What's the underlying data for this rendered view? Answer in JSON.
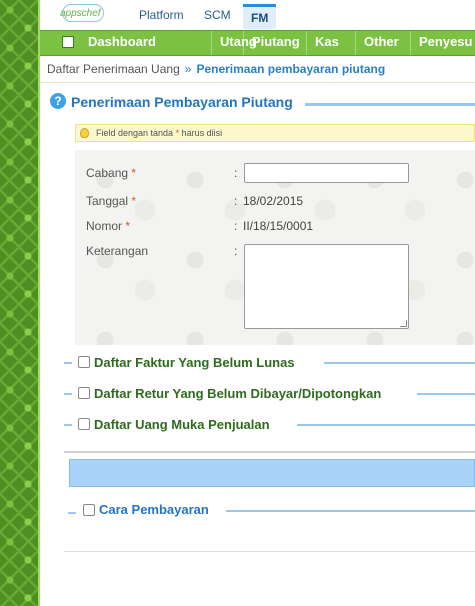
{
  "top_nav": {
    "logo": "appschef",
    "tabs": [
      "Platform",
      "SCM",
      "FM"
    ],
    "active_tab": "FM"
  },
  "menu": {
    "items": [
      "Dashboard",
      "Utang",
      "Piutang",
      "Kas",
      "Other",
      "Penyesu"
    ]
  },
  "breadcrumb": {
    "parent": "Daftar Penerimaan Uang",
    "separator": "»",
    "current": "Penerimaan pembayaran piutang"
  },
  "page": {
    "title": "Penerimaan Pembayaran Piutang"
  },
  "notice": {
    "prefix": "Field dengan tanda",
    "star": "*",
    "suffix": "harus diisi"
  },
  "form": {
    "cabang_label": "Cabang",
    "tanggal_label": "Tanggal",
    "tanggal_value": "18/02/2015",
    "nomor_label": "Nomor",
    "nomor_value": "II/18/15/0001",
    "keterangan_label": "Keterangan",
    "required_mark": "*",
    "colon": ":"
  },
  "sections": {
    "faktur": "Daftar Faktur Yang Belum Lunas",
    "retur": "Daftar Retur Yang Belum Dibayar/Dipotongkan",
    "uang_muka": "Daftar Uang Muka Penjualan",
    "cara_pembayaran": "Cara Pembayaran"
  },
  "colors": {
    "menu_green": "#7cc242",
    "title_blue": "#2475bf",
    "section_green": "#2e6b1e"
  }
}
